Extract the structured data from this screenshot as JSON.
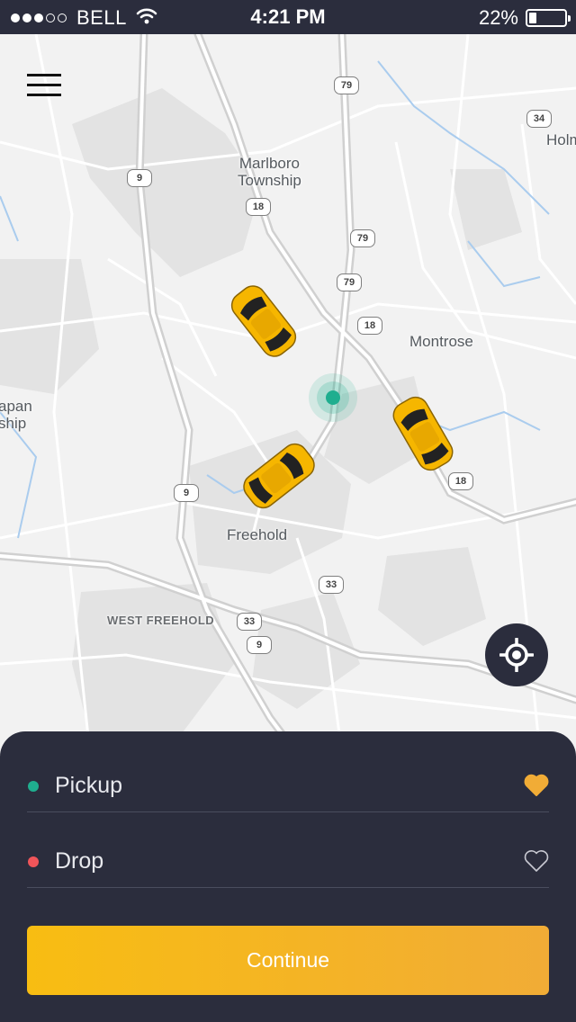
{
  "status_bar": {
    "signal_filled": 3,
    "signal_empty": 2,
    "carrier": "BELL",
    "time": "4:21 PM",
    "battery_text": "22%",
    "battery_level": 0.22
  },
  "map": {
    "places": {
      "marlboro": "Marlboro\nTownship",
      "montrose": "Montrose",
      "freehold": "Freehold",
      "west_freehold": "WEST FREEHOLD",
      "holm": "Holm",
      "manalapan": "apan\nship"
    },
    "route_shields": {
      "r79_top": "79",
      "r34": "34",
      "r9_top": "9",
      "r18_a": "18",
      "r79_b": "79",
      "r79_c": "79",
      "r18_b": "18",
      "r9_mid": "9",
      "r18_c": "18",
      "r33_a": "33",
      "r33_b": "33",
      "r9_bot": "9"
    },
    "menu_icon": "hamburger-menu-icon",
    "locate_icon": "crosshair-target-icon",
    "car_icon": "taxi-car-icon",
    "car_count": 3
  },
  "booking": {
    "pickup_label": "Pickup",
    "pickup_dot_color": "#1fae8f",
    "pickup_favorite": true,
    "drop_label": "Drop",
    "drop_dot_color": "#f0555a",
    "drop_favorite": false,
    "continue_label": "Continue"
  },
  "colors": {
    "dark": "#2b2d3d",
    "accent_yellow": "#f8bd12",
    "accent_orange": "#f1ac36",
    "location_green": "#1fae8f"
  }
}
